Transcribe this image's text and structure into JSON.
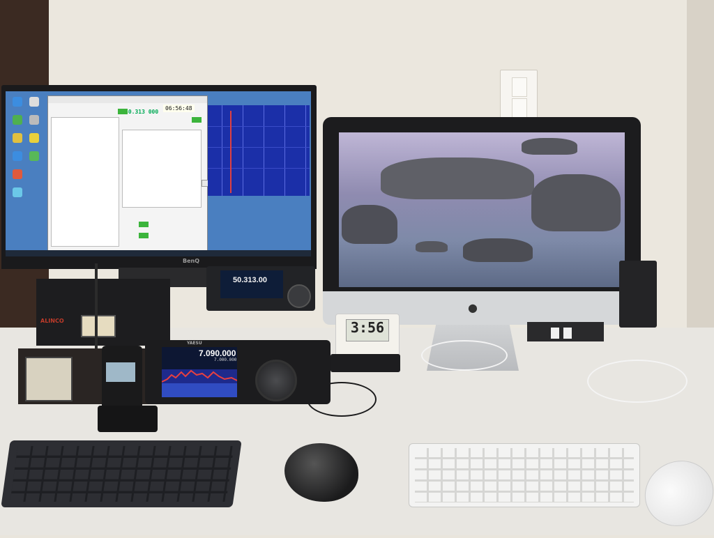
{
  "scene": {
    "description_items": [
      "benq-monitor",
      "imac",
      "radios",
      "keyboards",
      "mice",
      "desk-clock"
    ]
  },
  "benq": {
    "brand": "BenQ",
    "app_freq": "50.313 000",
    "app_time": "06:56:48"
  },
  "radio_top": {
    "frequency": "50.313.00"
  },
  "radio_main": {
    "brand": "YAESU",
    "frequency": "7.090.000",
    "sub_frequency": "7.000.000"
  },
  "amplifier": {
    "brand": "ALINCO"
  },
  "clock": {
    "time": "3:56"
  },
  "colors": {
    "wall": "#ebe7de",
    "desk": "#e8e6e1",
    "waterfall": "#1b2fa8",
    "imac_sky": "#bfb6d6"
  }
}
